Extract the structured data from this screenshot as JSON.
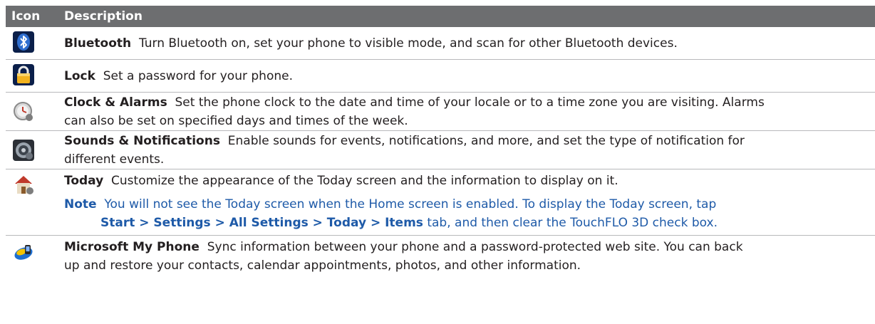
{
  "header": {
    "icon_col": "Icon",
    "desc_col": "Description"
  },
  "rows": [
    {
      "title": "Bluetooth",
      "text": "Turn Bluetooth on, set your phone to visible mode, and scan for other Bluetooth devices.",
      "icon": "bluetooth-icon"
    },
    {
      "title": "Lock",
      "text": "Set a password for your phone.",
      "icon": "lock-icon"
    },
    {
      "title": "Clock & Alarms",
      "text_1": "Set the phone clock to the date and time of your locale or to a time zone you are visiting. Alarms",
      "text_2": "can also be set on specified days and times of the week.",
      "icon": "clock-icon"
    },
    {
      "title": "Sounds & Notifications",
      "text_1": "Enable sounds for events, notifications, and more, and set the type of notification for",
      "text_2": "different events.",
      "icon": "speaker-icon"
    },
    {
      "title": "Today",
      "text": "Customize the appearance of the Today screen and the information to display on it.",
      "icon": "today-icon",
      "note_label": "Note",
      "note_text_1": "You will not see the Today screen when the Home screen is enabled. To display the Today screen, tap",
      "note_path": "Start > Settings > All Settings > Today > Items",
      "note_text_2": "tab, and then clear the TouchFLO 3D check box."
    },
    {
      "title": "Microsoft My Phone",
      "text_1": "Sync information between your phone and a password-protected web site. You can back",
      "text_2": "up and restore your contacts, calendar appointments, photos, and other information.",
      "icon": "my-phone-icon"
    }
  ],
  "colors": {
    "header_bg": "#6d6e70",
    "note_blue": "#1e5aa8",
    "divider": "#b8b9bb"
  }
}
